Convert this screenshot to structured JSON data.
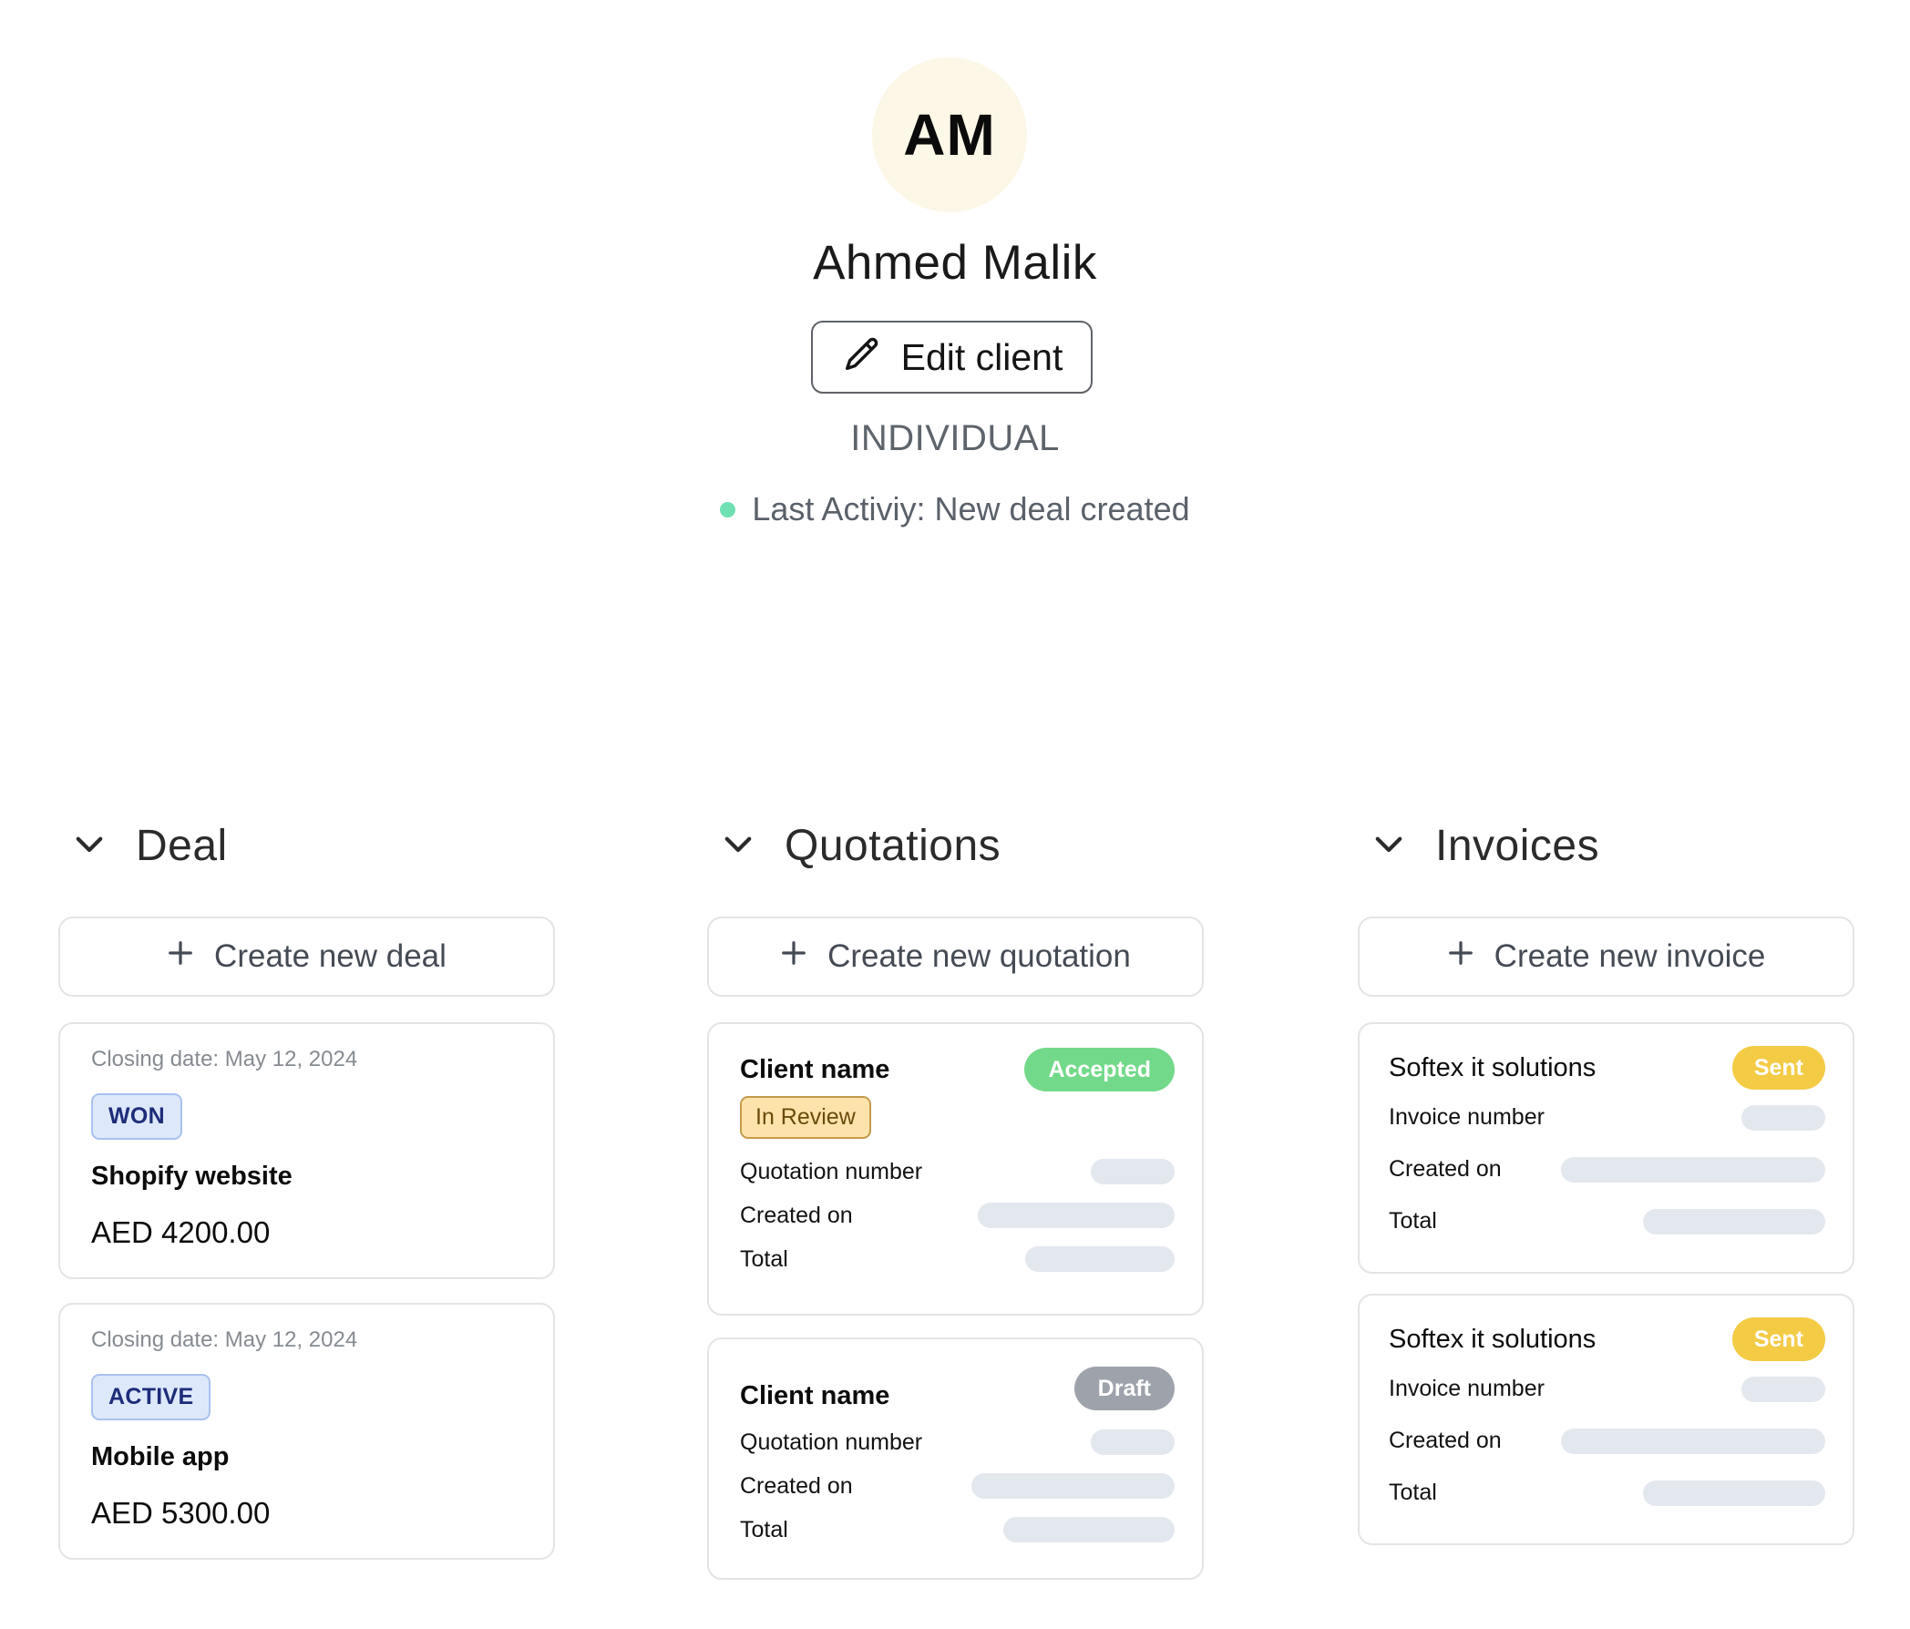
{
  "profile": {
    "initials": "AM",
    "name": "Ahmed Malik",
    "edit_label": "Edit client",
    "client_type": "INDIVIDUAL",
    "last_activity": "Last Activiy: New deal created",
    "activity_status_color": "#6ee0b2",
    "avatar_color": "#fcf7e6"
  },
  "deal": {
    "title": "Deal",
    "create_label": "Create new deal",
    "cards": [
      {
        "closing": "Closing date: May 12, 2024",
        "status": "WON",
        "name": "Shopify website",
        "amount": "AED 4200.00"
      },
      {
        "closing": "Closing date: May 12, 2024",
        "status": "ACTIVE",
        "name": "Mobile app",
        "amount": "AED 5300.00"
      }
    ]
  },
  "quotations": {
    "title": "Quotations",
    "create_label": "Create new quotation",
    "cards": [
      {
        "client": "Client name",
        "status": "Accepted",
        "status_color": "#73d98a",
        "tag": "In Review",
        "fields": [
          "Quotation number",
          "Created on",
          "Total"
        ]
      },
      {
        "client": "Client name",
        "status": "Draft",
        "status_color": "#9ea3ab",
        "fields": [
          "Quotation number",
          "Created on",
          "Total"
        ]
      }
    ]
  },
  "invoices": {
    "title": "Invoices",
    "create_label": "Create new invoice",
    "cards": [
      {
        "client": "Softex it solutions",
        "status": "Sent",
        "status_color": "#f3cb45",
        "fields": [
          "Invoice number",
          "Created on",
          "Total"
        ]
      },
      {
        "client": "Softex it solutions",
        "status": "Sent",
        "status_color": "#f3cb45",
        "fields": [
          "Invoice number",
          "Created on",
          "Total"
        ]
      }
    ]
  }
}
